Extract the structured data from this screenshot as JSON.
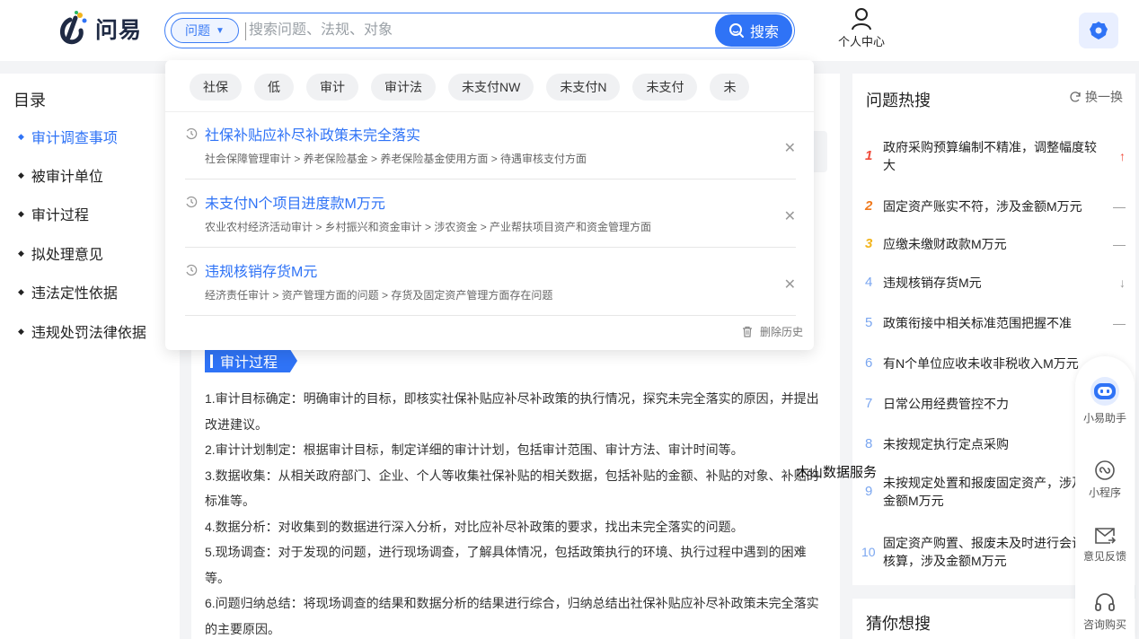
{
  "header": {
    "logo_text": "问易",
    "search_type": "问题",
    "search_placeholder": "搜索问题、法规、对象",
    "search_button": "搜索",
    "user_center": "个人中心"
  },
  "toc": {
    "title": "目录",
    "items": [
      {
        "label": "审计调查事项",
        "active": true
      },
      {
        "label": "被审计单位"
      },
      {
        "label": "审计过程"
      },
      {
        "label": "拟处理意见"
      },
      {
        "label": "违法定性依据"
      },
      {
        "label": "违规处罚法律依据"
      }
    ]
  },
  "dropdown": {
    "chips": [
      "社保",
      "低",
      "审计",
      "审计法",
      "未支付NW",
      "未支付N",
      "未支付",
      "未"
    ],
    "history": [
      {
        "title": "社保补贴应补尽补政策未完全落实",
        "path": "社会保障管理审计 > 养老保险基金 > 养老保险基金使用方面 > 待遇审核支付方面"
      },
      {
        "title": "未支付N个项目进度款M万元",
        "path": "农业农村经济活动审计 > 乡村振兴和资金审计 > 涉农资金 > 产业帮扶项目资产和资金管理方面"
      },
      {
        "title": "违规核销存货M元",
        "path": "经济责任审计 > 资产管理方面的问题 > 存货及固定资产管理方面存在问题"
      }
    ],
    "clear_history": "删除历史"
  },
  "main": {
    "section_title": "审计过程",
    "paragraphs": [
      "1.审计目标确定：明确审计的目标，即核实社保补贴应补尽补政策的执行情况，探究未完全落实的原因，并提出改进建议。",
      "2.审计计划制定：根据审计目标，制定详细的审计计划，包括审计范围、审计方法、审计时间等。",
      "3.数据收集：从相关政府部门、企业、个人等收集社保补贴的相关数据，包括补贴的金额、补贴的对象、补贴的标准等。",
      "4.数据分析：对收集到的数据进行深入分析，对比应补尽补政策的要求，找出未完全落实的问题。",
      "5.现场调查：对于发现的问题，进行现场调查，了解具体情况，包括政策执行的环境、执行过程中遇到的困难等。",
      "6.问题归纳总结：将现场调查的结果和数据分析的结果进行综合，归纳总结出社保补贴应补尽补政策未完全落实的主要原因。"
    ]
  },
  "hot": {
    "title": "问题热搜",
    "refresh": "换一换",
    "items": [
      {
        "rank": "1",
        "text": "政府采购预算编制不精准，调整幅度较大",
        "trend": "↑"
      },
      {
        "rank": "2",
        "text": "固定资产账实不符，涉及金额M万元",
        "trend": "—"
      },
      {
        "rank": "3",
        "text": "应缴未缴财政款M万元",
        "trend": "—"
      },
      {
        "rank": "4",
        "text": "违规核销存货M元",
        "trend": "↓"
      },
      {
        "rank": "5",
        "text": "政策衔接中相关标准范围把握不准",
        "trend": "—"
      },
      {
        "rank": "6",
        "text": "有N个单位应收未收非税收入M万元",
        "trend": ""
      },
      {
        "rank": "7",
        "text": "日常公用经费管控不力",
        "trend": ""
      },
      {
        "rank": "8",
        "text": "未按规定执行定点采购",
        "trend": ""
      },
      {
        "rank": "9",
        "text": "未按规定处置和报废固定资产，涉及金额M万元",
        "trend": ""
      },
      {
        "rank": "10",
        "text": "固定资产购置、报废未及时进行会计核算，涉及金额M万元",
        "trend": ""
      }
    ],
    "rank_colors": {
      "1": "#f04a3a",
      "2": "#f07a1e",
      "3": "#f2b41c",
      "default": "#7aa6f0"
    }
  },
  "guess": {
    "title": "猜你想搜"
  },
  "watermark": "木山数据服务",
  "float": {
    "assistant": "小易助手",
    "miniprogram": "小程序",
    "feedback": "意见反馈",
    "consult": "咨询购买"
  }
}
